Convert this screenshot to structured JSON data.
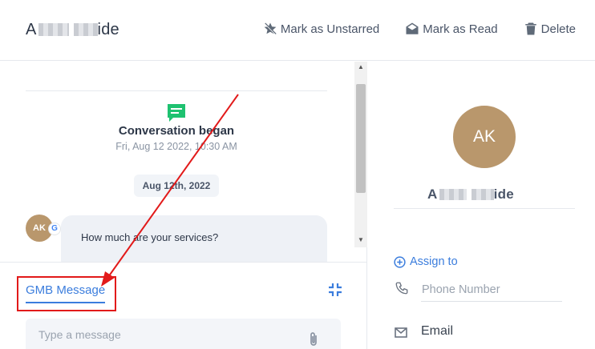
{
  "header": {
    "name_first": "A",
    "name_last": "ide",
    "actions": {
      "unstar": "Mark as Unstarred",
      "read": "Mark as Read",
      "delete": "Delete"
    }
  },
  "conversation": {
    "began_title": "Conversation began",
    "began_time": "Fri, Aug 12 2022, 10:30 AM",
    "date_separator": "Aug 12th, 2022",
    "message": {
      "avatar_initials": "AK",
      "channel_badge": "G",
      "text": "How much are your services?"
    }
  },
  "composer": {
    "tab_label": "GMB Message",
    "placeholder": "Type a message"
  },
  "contact_panel": {
    "avatar_initials": "AK",
    "name_first": "A",
    "name_last": "ide",
    "assign_label": "Assign to",
    "phone_placeholder": "Phone Number",
    "email_label": "Email"
  },
  "colors": {
    "accent": "#3b7ddd",
    "avatar": "#b9976c",
    "conversation_icon": "#1ec270",
    "annotation": "#e21a1a"
  }
}
